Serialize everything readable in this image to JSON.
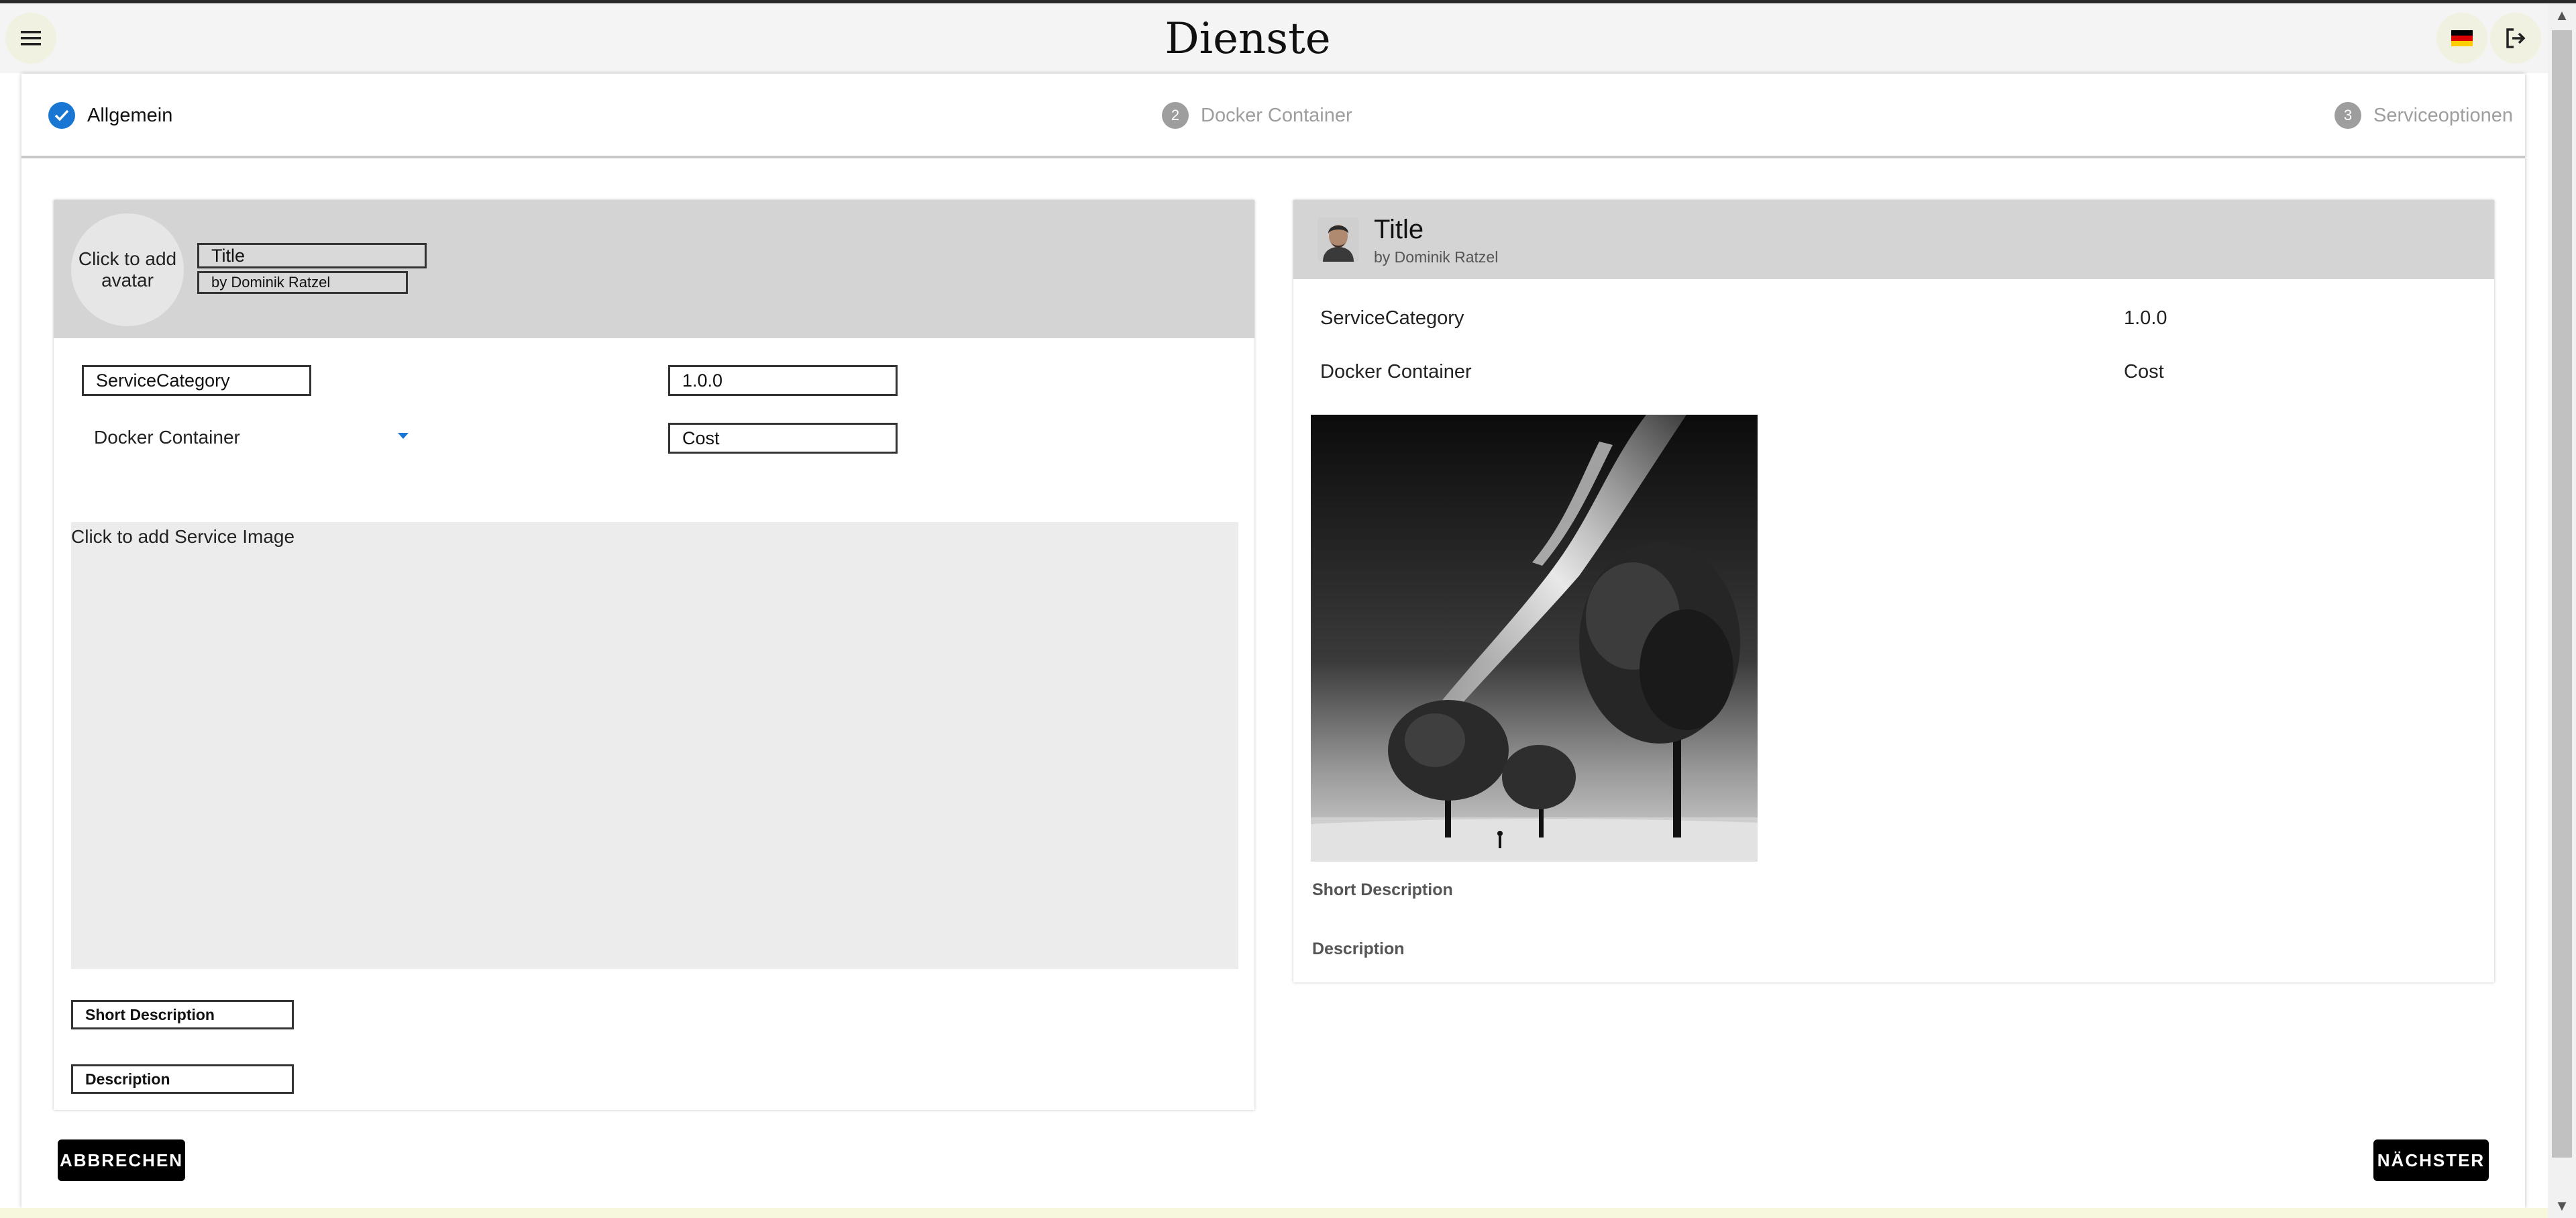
{
  "appbar": {
    "title": "Dienste",
    "menu_icon": "menu-icon",
    "flag_icon": "german-flag-icon",
    "logout_icon": "logout-icon"
  },
  "stepper": {
    "steps": [
      {
        "number": "1",
        "label": "Allgemein",
        "state": "completed"
      },
      {
        "number": "2",
        "label": "Docker Container",
        "state": "inactive"
      },
      {
        "number": "3",
        "label": "Serviceoptionen",
        "state": "inactive"
      }
    ]
  },
  "editor": {
    "avatar_prompt": "Click to add avatar",
    "title_value": "Title",
    "author_value": "by Dominik Ratzel",
    "category_value": "ServiceCategory",
    "version_value": "1.0.0",
    "container_select": "Docker Container",
    "cost_value": "Cost",
    "image_prompt": "Click to add Service Image",
    "short_description_value": "Short Description",
    "description_value": "Description"
  },
  "preview": {
    "title": "Title",
    "author": "by Dominik Ratzel",
    "category": "ServiceCategory",
    "version": "1.0.0",
    "container": "Docker Container",
    "cost": "Cost",
    "short_description_label": "Short Description",
    "description_label": "Description"
  },
  "actions": {
    "cancel_label": "ABBRECHEN",
    "next_label": "NÄCHSTER"
  },
  "colors": {
    "accent": "#1976d2",
    "inactive_step": "#9e9e9e",
    "header_gray": "#d4d4d4"
  }
}
